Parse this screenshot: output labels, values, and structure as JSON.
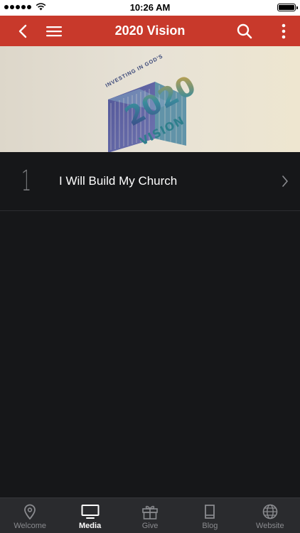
{
  "status_bar": {
    "time": "10:26 AM"
  },
  "header": {
    "title": "2020 Vision"
  },
  "banner": {
    "arc_text": "INVESTING IN GOD'S",
    "big_text": "2020",
    "sub_text": "VISION"
  },
  "list": {
    "items": [
      {
        "number": "1",
        "title": "I Will Build My Church"
      }
    ]
  },
  "tabbar": {
    "tabs": [
      {
        "label": "Welcome",
        "icon": "location-pin-icon"
      },
      {
        "label": "Media",
        "icon": "tv-icon",
        "active": true
      },
      {
        "label": "Give",
        "icon": "gift-icon"
      },
      {
        "label": "Blog",
        "icon": "book-icon"
      },
      {
        "label": "Website",
        "icon": "globe-icon"
      }
    ]
  },
  "colors": {
    "accent": "#c8392b",
    "background": "#161719",
    "tabbar": "#2a2b2e"
  }
}
